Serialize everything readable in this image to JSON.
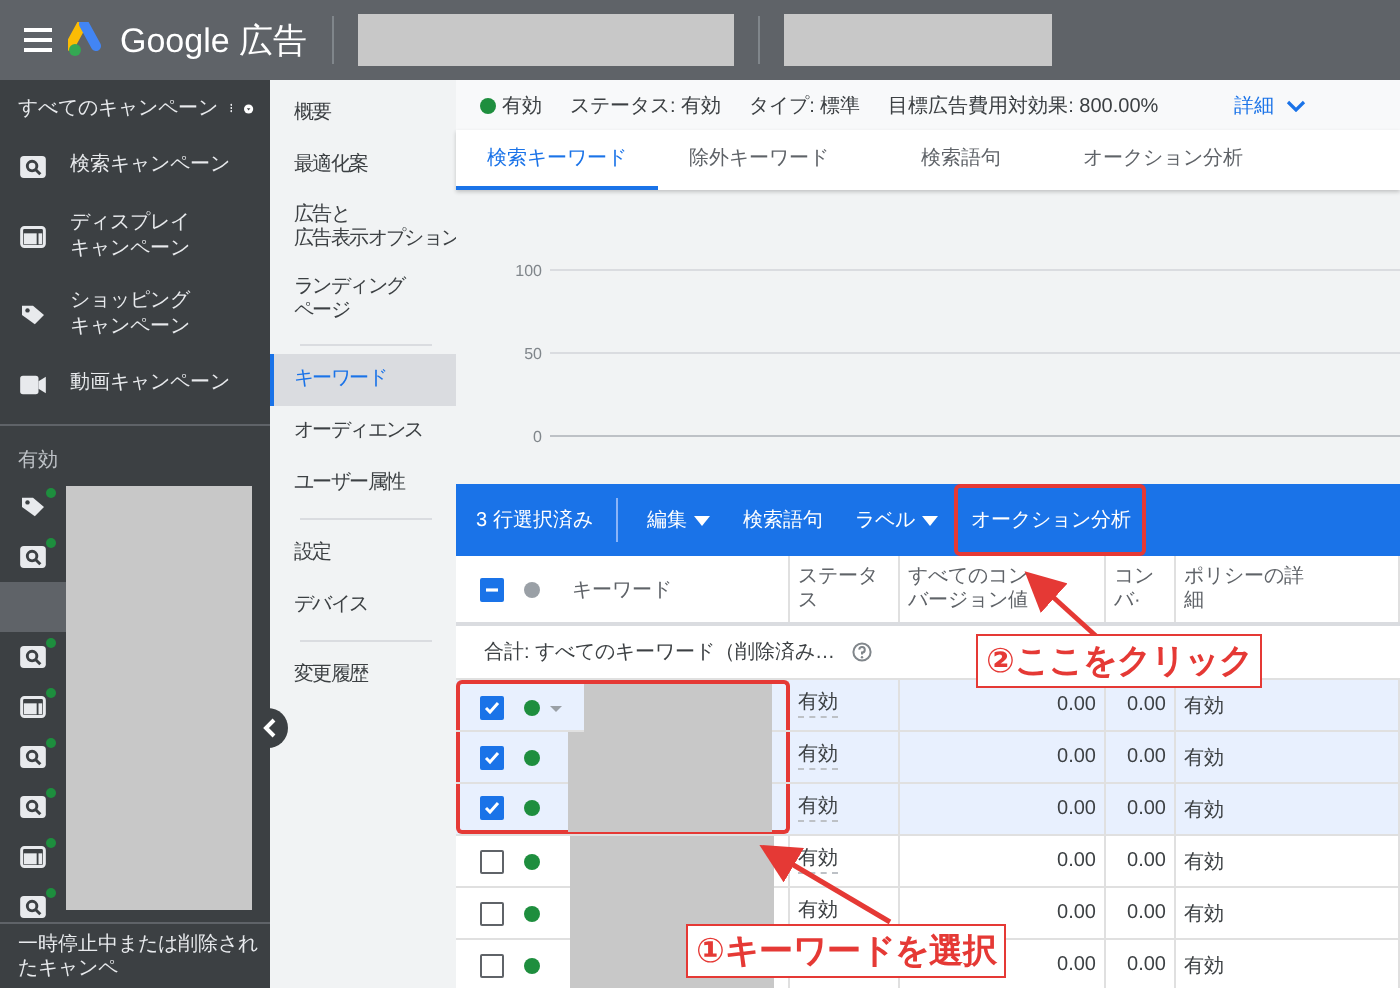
{
  "top_bar": {
    "product": "Google 広告"
  },
  "sidebar": {
    "title": "すべてのキャンペーン",
    "types": [
      {
        "kind": "search",
        "lines": [
          "検索キャンペーン"
        ]
      },
      {
        "kind": "display",
        "lines": [
          "ディスプレイ",
          "キャンペーン"
        ]
      },
      {
        "kind": "shopping",
        "lines": [
          "ショッピング",
          "キャンペーン"
        ]
      },
      {
        "kind": "video",
        "lines": [
          "動画キャンペーン"
        ]
      }
    ],
    "section": "有効",
    "campaigns": [
      {
        "kind": "shopping",
        "selected": false
      },
      {
        "kind": "search",
        "selected": false
      },
      {
        "kind": "blank",
        "selected": true
      },
      {
        "kind": "search",
        "selected": false
      },
      {
        "kind": "display",
        "selected": false
      },
      {
        "kind": "search",
        "selected": false
      },
      {
        "kind": "search",
        "selected": false
      },
      {
        "kind": "display",
        "selected": false
      },
      {
        "kind": "search",
        "selected": false
      }
    ],
    "footer": "一時停止中または削除されたキャンペ"
  },
  "nav": {
    "groups": [
      [
        {
          "lines": [
            "概要"
          ],
          "selected": false
        },
        {
          "lines": [
            "最適化案"
          ],
          "selected": false
        },
        {
          "lines": [
            "広告と",
            "広告表示オプション"
          ],
          "selected": false
        },
        {
          "lines": [
            "ランディング",
            "ページ"
          ],
          "selected": false
        }
      ],
      [
        {
          "lines": [
            "キーワード"
          ],
          "selected": true
        },
        {
          "lines": [
            "オーディエンス"
          ],
          "selected": false
        },
        {
          "lines": [
            "ユーザー属性"
          ],
          "selected": false
        }
      ],
      [
        {
          "lines": [
            "設定"
          ],
          "selected": false
        },
        {
          "lines": [
            "デバイス"
          ],
          "selected": false
        }
      ],
      [
        {
          "lines": [
            "変更履歴"
          ],
          "selected": false
        }
      ]
    ]
  },
  "status_bar": {
    "state": "有効",
    "status": "ステータス: 有効",
    "type": "タイプ: 標準",
    "target": "目標広告費用対効果: 800.00%",
    "details": "詳細"
  },
  "tabs": [
    {
      "label": "検索キーワード",
      "selected": true
    },
    {
      "label": "除外キーワード",
      "selected": false
    },
    {
      "label": "検索語句",
      "selected": false
    },
    {
      "label": "オークション分析",
      "selected": false
    }
  ],
  "chart": {
    "tick_labels": [
      "100",
      "50",
      "0"
    ]
  },
  "action_bar": {
    "count": "3 行選択済み",
    "actions": [
      {
        "label": "編集",
        "dropdown": true,
        "highlighted": false
      },
      {
        "label": "検索語句",
        "dropdown": false,
        "highlighted": false
      },
      {
        "label": "ラベル",
        "dropdown": true,
        "highlighted": false
      },
      {
        "label": "オークション分析",
        "dropdown": false,
        "highlighted": true
      }
    ]
  },
  "table": {
    "select_all": {
      "checked": true,
      "indeterminate": true
    },
    "columns": [
      "キーワード",
      "ステータス",
      "すべてのコンバージョン値",
      "コンバ·",
      "ポリシーの詳細"
    ],
    "total": "合計: すべてのキーワード（削除済み…",
    "rows": [
      {
        "framed": true,
        "selected": true,
        "caret": true,
        "status": "有効",
        "conv_value": "0.00",
        "conversions": "0.00",
        "policy": "有効"
      },
      {
        "framed": true,
        "selected": true,
        "caret": false,
        "status": "有効",
        "conv_value": "0.00",
        "conversions": "0.00",
        "policy": "有効"
      },
      {
        "framed": true,
        "selected": true,
        "caret": false,
        "status": "有効",
        "conv_value": "0.00",
        "conversions": "0.00",
        "policy": "有効"
      },
      {
        "framed": false,
        "selected": false,
        "caret": false,
        "status": "有効",
        "conv_value": "0.00",
        "conversions": "0.00",
        "policy": "有効"
      },
      {
        "framed": false,
        "selected": false,
        "caret": false,
        "status": "有効",
        "conv_value": "0.00",
        "conversions": "0.00",
        "policy": "有効"
      },
      {
        "framed": false,
        "selected": false,
        "caret": false,
        "conv_value": "0.00",
        "conversions": "0.00",
        "policy": "有効"
      }
    ]
  },
  "annotations": [
    {
      "text": "①キーワードを選択"
    },
    {
      "text": "②ここをクリック"
    }
  ]
}
